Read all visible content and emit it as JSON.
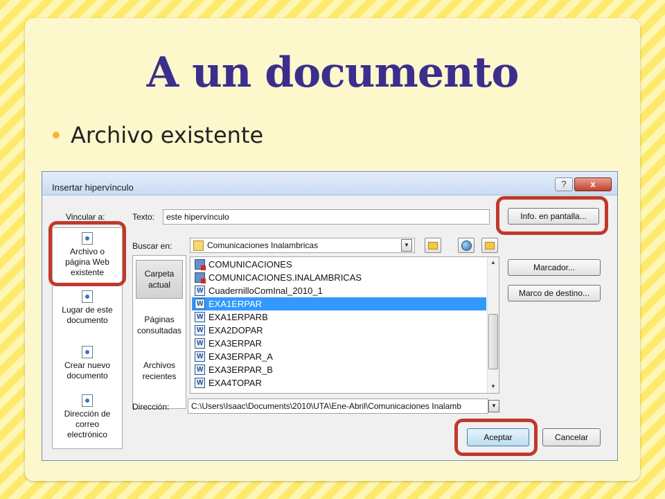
{
  "slide": {
    "title": "A un documento",
    "bullet": "Archivo existente"
  },
  "dialog": {
    "title": "Insertar hipervínculo",
    "help_label": "?",
    "close_label": "x",
    "link_to_label": "Vincular a:",
    "text_label": "Texto:",
    "text_value": "este hipervínculo",
    "screen_tip_button": "Info. en pantalla...",
    "look_in_label": "Buscar en:",
    "look_in_value": "Comunicaciones Inalambricas",
    "bookmark_button": "Marcador...",
    "target_frame_button": "Marco de destino...",
    "address_label": "Dirección:",
    "address_value": "C:\\Users\\Isaac\\Documents\\2010\\UTA\\Ene-Abril\\Comunicaciones Inalamb",
    "ok_button": "Aceptar",
    "cancel_button": "Cancelar",
    "sidebar": [
      {
        "line1": "Archivo o",
        "line2": "página Web",
        "line3": "existente"
      },
      {
        "line1": "Lugar de este",
        "line2": "documento"
      },
      {
        "line1": "Crear nuevo",
        "line2": "documento"
      },
      {
        "line1": "Dirección de",
        "line2": "correo",
        "line3": "electrónico"
      }
    ],
    "look_panel": [
      {
        "line1": "Carpeta",
        "line2": "actual"
      },
      {
        "line1": "Páginas",
        "line2": "consultadas"
      },
      {
        "line1": "Archivos",
        "line2": "recientes"
      }
    ],
    "files": [
      {
        "name": "COMUNICACIONES",
        "icon": "folder-icon",
        "selected": false
      },
      {
        "name": "COMUNICACIONES.INALAMBRICAS",
        "icon": "folder-icon",
        "selected": false
      },
      {
        "name": "CuadernilloComInal_2010_1",
        "icon": "word-doc-icon",
        "selected": false
      },
      {
        "name": "EXA1ERPAR",
        "icon": "word-doc-icon",
        "selected": true
      },
      {
        "name": "EXA1ERPARB",
        "icon": "word-doc-icon",
        "selected": false
      },
      {
        "name": "EXA2DOPAR",
        "icon": "word-doc-icon",
        "selected": false
      },
      {
        "name": "EXA3ERPAR",
        "icon": "word-doc-icon",
        "selected": false
      },
      {
        "name": "EXA3ERPAR_A",
        "icon": "word-doc-icon",
        "selected": false
      },
      {
        "name": "EXA3ERPAR_B",
        "icon": "word-doc-icon",
        "selected": false
      },
      {
        "name": "EXA4TOPAR",
        "icon": "word-doc-icon",
        "selected": false
      }
    ]
  },
  "colors": {
    "title": "#3b2e8c",
    "highlight": "#c0392b",
    "selection": "#3399ff",
    "bullet": "#f4b43a"
  }
}
